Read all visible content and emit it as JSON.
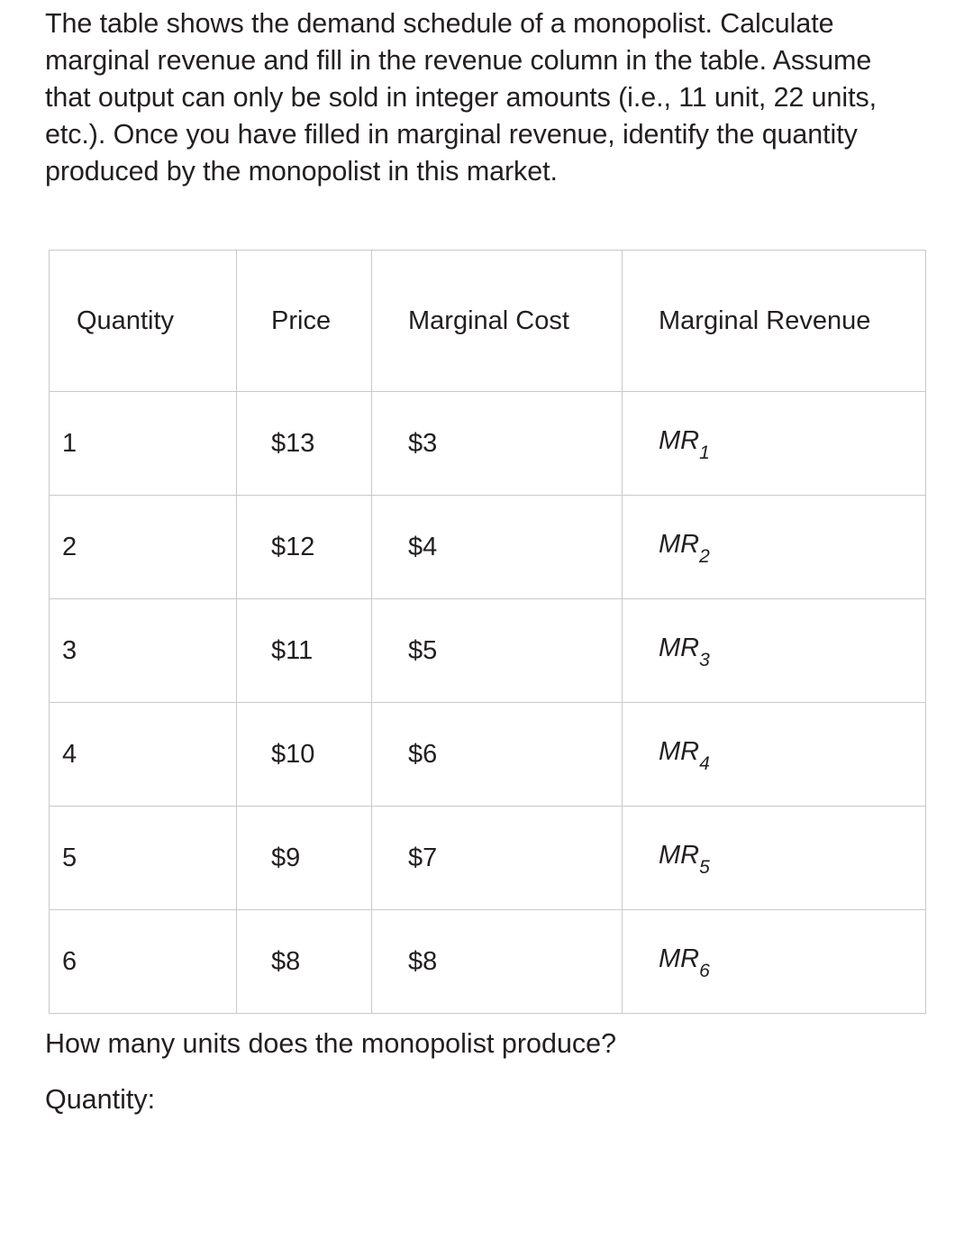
{
  "prompt": {
    "text": "The table shows the demand schedule of a monopolist. Calculate marginal revenue and fill in the revenue column in the table. Assume that output can only be sold in integer amounts (i.e., 11 unit, 22 units, etc.). Once you have filled in marginal revenue, identify the quantity produced by the monopolist in this market."
  },
  "table": {
    "headers": {
      "quantity": "Quantity",
      "price": "Price",
      "marginal_cost": "Marginal Cost",
      "marginal_revenue": "Marginal Revenue"
    },
    "rows": [
      {
        "quantity": "1",
        "price": "$13",
        "marginal_cost": "$3",
        "mr_base": "MR",
        "mr_sub": "1"
      },
      {
        "quantity": "2",
        "price": "$12",
        "marginal_cost": "$4",
        "mr_base": "MR",
        "mr_sub": "2"
      },
      {
        "quantity": "3",
        "price": "$11",
        "marginal_cost": "$5",
        "mr_base": "MR",
        "mr_sub": "3"
      },
      {
        "quantity": "4",
        "price": "$10",
        "marginal_cost": "$6",
        "mr_base": "MR",
        "mr_sub": "4"
      },
      {
        "quantity": "5",
        "price": "$9",
        "marginal_cost": "$7",
        "mr_base": "MR",
        "mr_sub": "5"
      },
      {
        "quantity": "6",
        "price": "$8",
        "marginal_cost": "$8",
        "mr_base": "MR",
        "mr_sub": "6"
      }
    ]
  },
  "footer": {
    "question": "How many units does the monopolist produce?",
    "answer_label": "Quantity:"
  },
  "colors": {
    "text": "#231f20",
    "border": "#c9c9cd",
    "background": "#ffffff"
  }
}
